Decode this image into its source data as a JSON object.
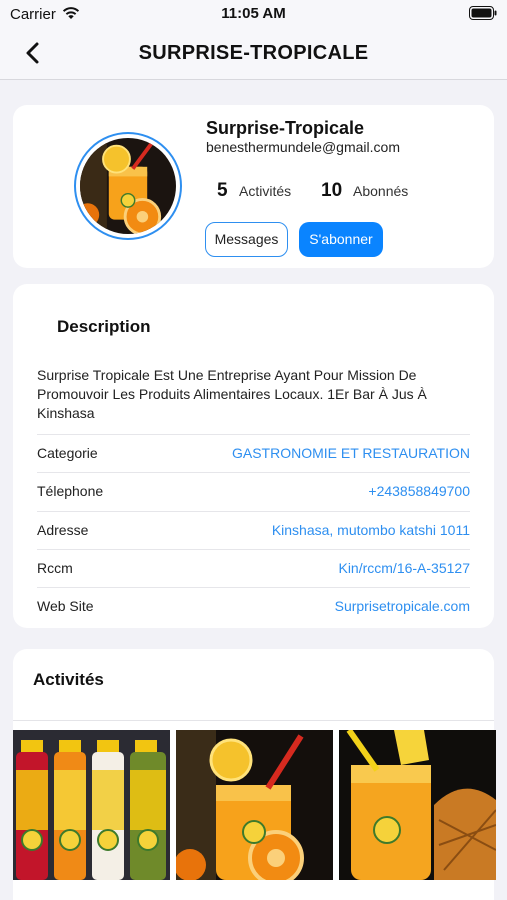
{
  "status": {
    "carrier": "Carrier",
    "time": "11:05 AM"
  },
  "nav": {
    "title": "SURPRISE-TROPICALE"
  },
  "profile": {
    "name": "Surprise-Tropicale",
    "email": "benesthermundele@gmail.com",
    "activities_count": "5",
    "activities_label": "Activités",
    "followers_count": "10",
    "followers_label": "Abonnés",
    "messages_label": "Messages",
    "follow_label": "S'abonner"
  },
  "info": {
    "description_title": "Description",
    "description": "Surprise Tropicale Est Une Entreprise Ayant Pour Mission De Promouvoir Les Produits Alimentaires Locaux. 1Er Bar À Jus À Kinshasa",
    "rows": [
      {
        "label": "Categorie",
        "value": "GASTRONOMIE ET RESTAURATION"
      },
      {
        "label": "Télephone",
        "value": "+243858849700"
      },
      {
        "label": "Adresse",
        "value": "Kinshasa, mutombo katshi 1011"
      },
      {
        "label": "Rccm",
        "value": "Kin/rccm/16-A-35127"
      },
      {
        "label": "Web Site",
        "value": "Surprisetropicale.com"
      }
    ]
  },
  "activities": {
    "title": "Activités"
  },
  "colors": {
    "accent": "#0a84ff",
    "link": "#2e8ff0",
    "background": "#f2f2f7"
  }
}
